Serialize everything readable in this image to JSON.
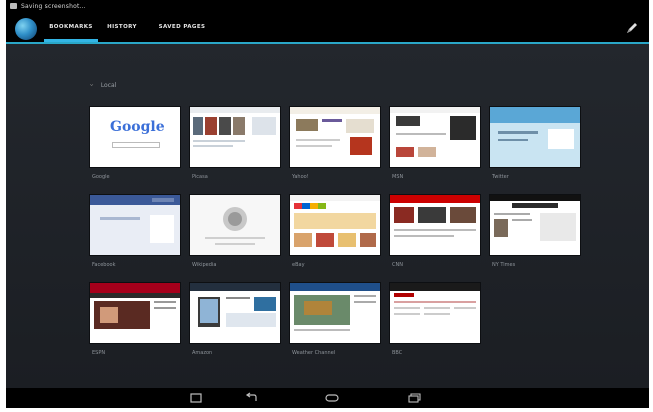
{
  "status_bar": {
    "title": "Saving screenshot..."
  },
  "tabs": [
    {
      "label": "BOOKMARKS"
    },
    {
      "label": "HISTORY"
    },
    {
      "label": "SAVED PAGES"
    }
  ],
  "folder": {
    "label": "Local"
  },
  "bookmarks": [
    {
      "label": "Google"
    },
    {
      "label": "Picasa"
    },
    {
      "label": "Yahoo!"
    },
    {
      "label": "MSN"
    },
    {
      "label": "Twitter"
    },
    {
      "label": "Facebook"
    },
    {
      "label": "Wikipedia"
    },
    {
      "label": "eBay"
    },
    {
      "label": "CNN"
    },
    {
      "label": "NY Times"
    },
    {
      "label": "ESPN"
    },
    {
      "label": "Amazon"
    },
    {
      "label": "Weather Channel"
    },
    {
      "label": "BBC"
    }
  ],
  "google_logo": "Google",
  "colors": {
    "accent": "#33b5e5",
    "background": "#1e2228"
  }
}
